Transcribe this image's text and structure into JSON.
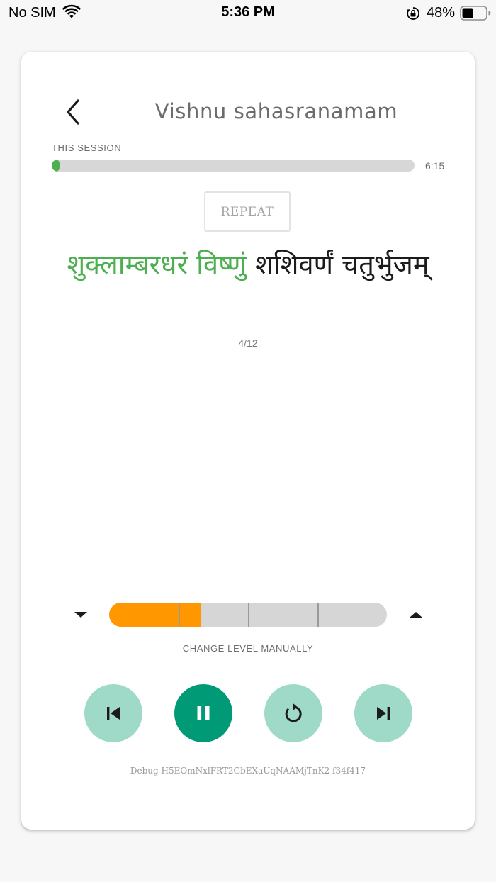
{
  "status_bar": {
    "carrier": "No SIM",
    "time": "5:36 PM",
    "battery_percent": "48%",
    "battery_level": 0.48,
    "icons": [
      "wifi-icon",
      "orientation-lock-icon",
      "battery-icon"
    ]
  },
  "header": {
    "back_icon": "chevron-left-icon",
    "title": "Vishnu sahasranamam"
  },
  "session": {
    "label": "THIS SESSION",
    "progress": 0.02,
    "time": "6:15",
    "color": "#4caf50"
  },
  "repeat": {
    "label": "REPEAT"
  },
  "verse": {
    "active_text": "शुक्लाम्बरधरं विष्णुं",
    "pending_text": "शशिवर्णं चतुर्भुजम्",
    "active_color": "#4caf50"
  },
  "counter": "4/12",
  "level": {
    "value": 0.33,
    "segments": 4,
    "caption": "CHANGE LEVEL MANUALLY",
    "fill_color": "#ff9800",
    "down_icon": "triangle-down-icon",
    "up_icon": "triangle-up-icon"
  },
  "controls": {
    "prev_icon": "skip-previous-icon",
    "pause_icon": "pause-icon",
    "replay_icon": "replay-icon",
    "next_icon": "skip-next-icon",
    "light_color": "#9fd9c8",
    "dark_color": "#009b76"
  },
  "debug": "Debug H5EOmNxlFRT2GbEXaUqNAAMjTnK2 f34f417"
}
